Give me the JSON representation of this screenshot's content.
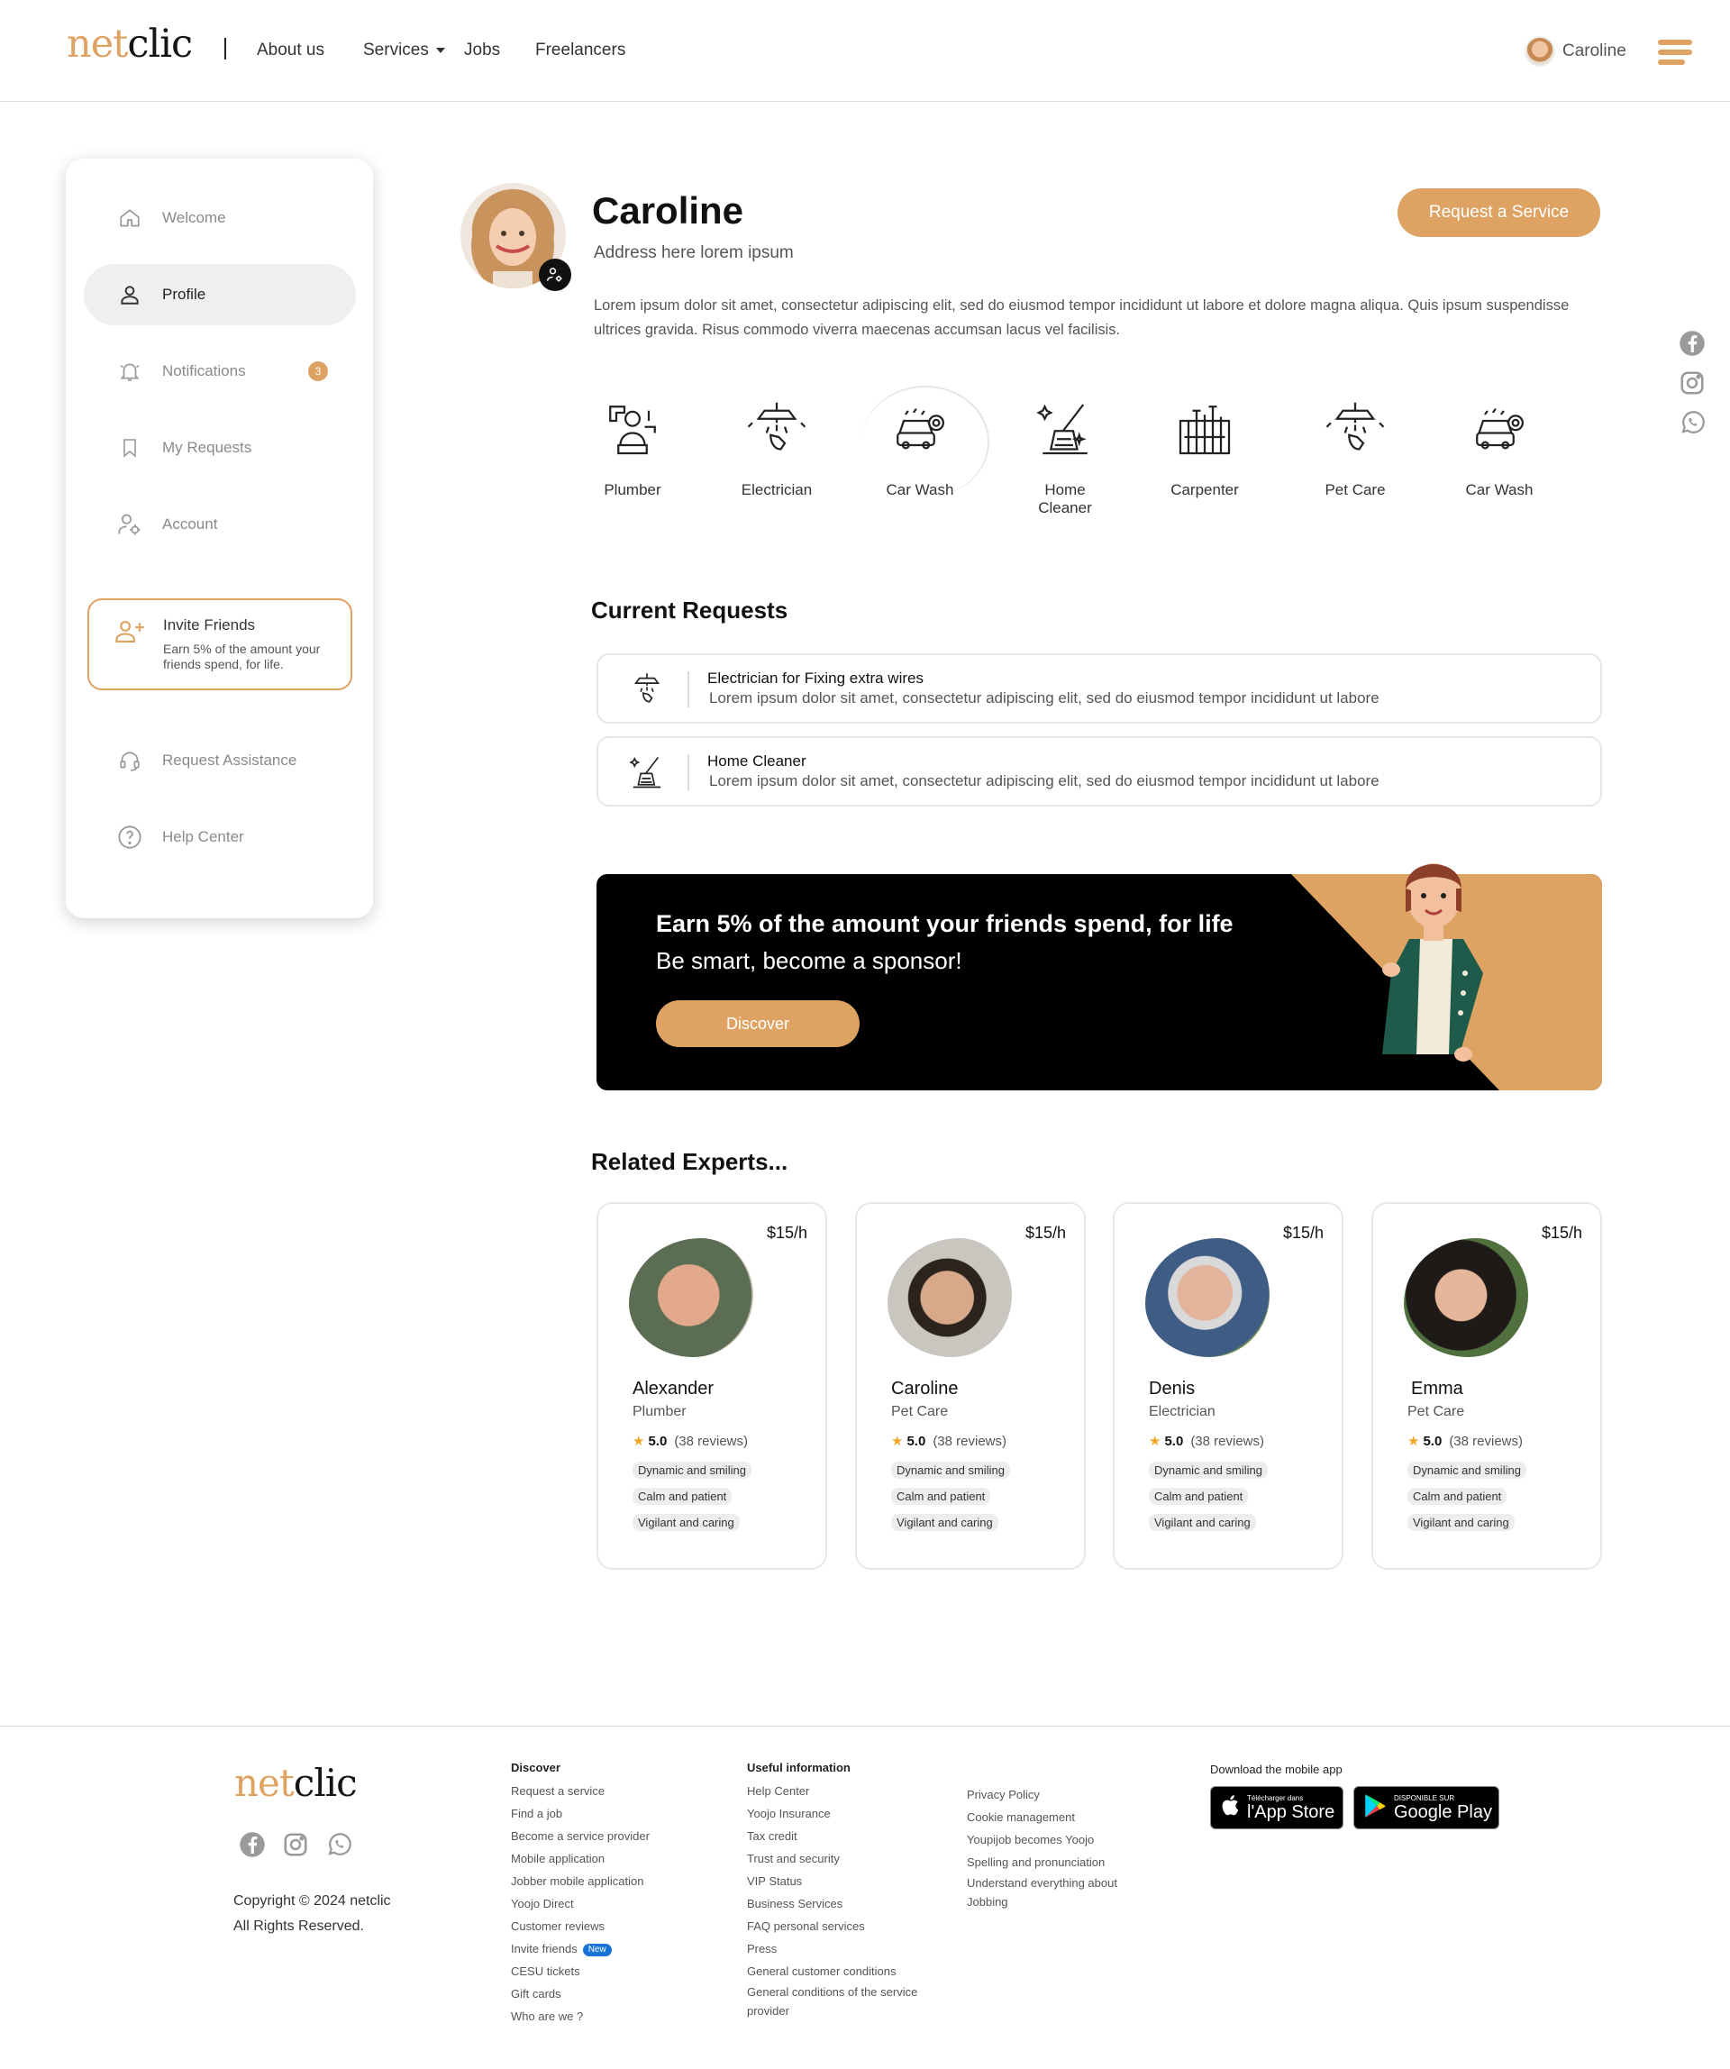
{
  "brand": {
    "logo_a": "net",
    "logo_b": "clic",
    "accent": "#dea363"
  },
  "nav": {
    "about": "About us",
    "services": "Services",
    "jobs": "Jobs",
    "freelancers": "Freelancers"
  },
  "header_user": {
    "name": "Caroline"
  },
  "sidebar": {
    "items": [
      {
        "label": "Welcome",
        "icon": "home-icon"
      },
      {
        "label": "Profile",
        "icon": "user-icon"
      },
      {
        "label": "Notifications",
        "icon": "bell-icon",
        "badge": "3"
      },
      {
        "label": "My Requests",
        "icon": "bookmark-icon"
      },
      {
        "label": "Account",
        "icon": "user-gear-icon"
      }
    ],
    "invite": {
      "title": "Invite Friends",
      "subtitle": "Earn 5% of the amount your friends spend, for life."
    },
    "bottom": [
      {
        "label": "Request Assistance",
        "icon": "headset-icon"
      },
      {
        "label": "Help Center",
        "icon": "question-icon"
      }
    ]
  },
  "profile": {
    "name": "Caroline",
    "address": "Address here lorem ipsum",
    "description": "Lorem ipsum dolor sit amet, consectetur adipiscing elit, sed do eiusmod tempor incididunt ut labore et dolore magna aliqua. Quis ipsum suspendisse ultrices gravida. Risus commodo viverra maecenas accumsan lacus vel facilisis.",
    "request_button": "Request a Service"
  },
  "services": [
    {
      "label": "Plumber",
      "icon": "plumber-icon"
    },
    {
      "label": "Electrician",
      "icon": "electrician-icon"
    },
    {
      "label": "Car Wash",
      "icon": "car-wash-icon"
    },
    {
      "label": "Home\nCleaner",
      "icon": "home-cleaner-icon"
    },
    {
      "label": "Carpenter",
      "icon": "carpenter-icon"
    },
    {
      "label": "Pet Care",
      "icon": "pet-care-icon"
    },
    {
      "label": "Car Wash",
      "icon": "car-wash-icon"
    }
  ],
  "current_requests": {
    "title": "Current Requests",
    "items": [
      {
        "title": "Electrician for Fixing extra wires",
        "desc": "Lorem ipsum dolor sit amet, consectetur adipiscing elit, sed do eiusmod tempor incididunt ut labore",
        "icon": "electrician-icon"
      },
      {
        "title": "Home Cleaner",
        "desc": "Lorem ipsum dolor sit amet, consectetur adipiscing elit, sed do eiusmod tempor incididunt ut labore",
        "icon": "home-cleaner-icon"
      }
    ]
  },
  "promo": {
    "title": "Earn 5% of the amount your friends spend, for life",
    "subtitle": "Be smart, become a sponsor!",
    "button": "Discover"
  },
  "experts": {
    "title": "Related Experts...",
    "items": [
      {
        "name": "Alexander",
        "role": "Plumber",
        "price": "$15/h",
        "rating": "5.0",
        "reviews": "(38 reviews)",
        "tags": [
          "Dynamic and smiling",
          "Calm and patient",
          "Vigilant and caring"
        ]
      },
      {
        "name": "Caroline",
        "role": "Pet Care",
        "price": "$15/h",
        "rating": "5.0",
        "reviews": "(38 reviews)",
        "tags": [
          "Dynamic and smiling",
          "Calm and patient",
          "Vigilant and caring"
        ]
      },
      {
        "name": "Denis",
        "role": "Electrician",
        "price": "$15/h",
        "rating": "5.0",
        "reviews": "(38 reviews)",
        "tags": [
          "Dynamic and smiling",
          "Calm and patient",
          "Vigilant and caring"
        ]
      },
      {
        "name": "Emma",
        "role": "Pet Care",
        "price": "$15/h",
        "rating": "5.0",
        "reviews": "(38 reviews)",
        "tags": [
          "Dynamic and smiling",
          "Calm and patient",
          "Vigilant and caring"
        ]
      }
    ]
  },
  "footer": {
    "copyright": "Copyright © 2024 netclic",
    "rights": "All Rights Reserved.",
    "discover": {
      "title": "Discover",
      "items": [
        "Request a service",
        "Find a job",
        "Become a service provider",
        "Mobile application",
        "Jobber mobile application",
        "Yoojo Direct",
        "Customer reviews",
        "Invite friends",
        "CESU tickets",
        "Gift cards",
        "Who are we ?"
      ],
      "new_badge": "New"
    },
    "useful": {
      "title": "Useful information",
      "items": [
        "Help Center",
        "Yoojo Insurance",
        "Tax credit",
        "Trust and security",
        "VIP Status",
        "Business Services",
        "FAQ personal services",
        "Press",
        "General customer conditions",
        "General conditions of the service provider"
      ]
    },
    "legal": {
      "items": [
        "Privacy Policy",
        "Cookie management",
        "Youpijob becomes Yoojo",
        "Spelling and pronunciation",
        "Understand everything about Jobbing"
      ]
    },
    "app": {
      "title": "Download the mobile app",
      "appstore_small": "Télécharger dans",
      "appstore_big": "l'App Store",
      "play_small": "DISPONIBLE SUR",
      "play_big": "Google Play"
    }
  }
}
